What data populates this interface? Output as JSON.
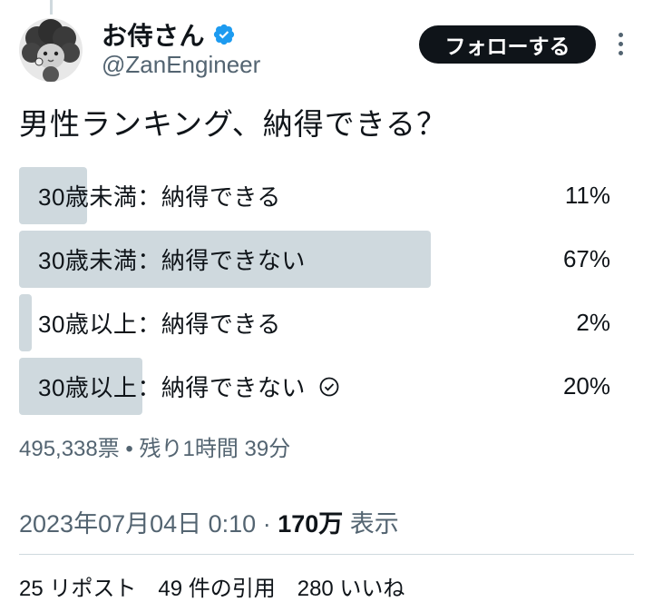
{
  "author": {
    "display_name": "お侍さん",
    "handle": "@ZanEngineer",
    "verified": true
  },
  "follow_label": "フォローする",
  "tweet_text": "男性ランキング、納得できる？",
  "poll": {
    "options": [
      {
        "label": "30歳未満：納得できる",
        "percent": "11%",
        "value": 11,
        "selected": false
      },
      {
        "label": "30歳未満：納得できない",
        "percent": "67%",
        "value": 67,
        "selected": false
      },
      {
        "label": "30歳以上：納得できる",
        "percent": "2%",
        "value": 2,
        "selected": false
      },
      {
        "label": "30歳以上：納得できない",
        "percent": "20%",
        "value": 20,
        "selected": true
      }
    ],
    "meta": "495,338票 • 残り1時間 39分"
  },
  "timestamp": "2023年07月04日 0:10",
  "views_count": "170万",
  "views_label": "表示",
  "stats_partial": "25 リポスト　49 件の引用　280 いいね",
  "colors": {
    "poll_fill": "#cfd9de",
    "verified": "#1d9bf0",
    "button": "#0f1419",
    "secondary_text": "#536471"
  }
}
